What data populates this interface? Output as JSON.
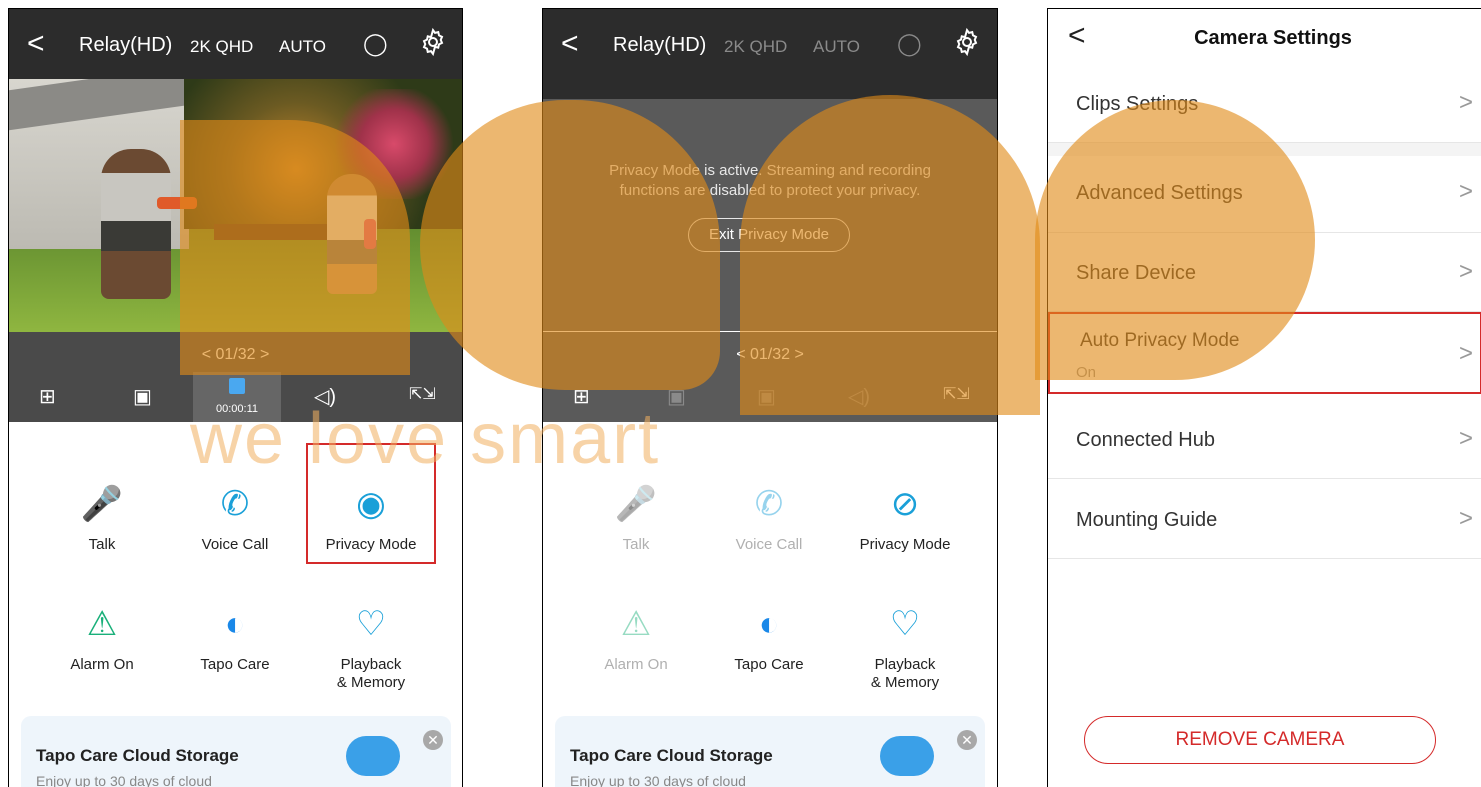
{
  "live_view": {
    "back": "<",
    "title": "Relay(HD)",
    "resolution": "2K QHD",
    "mode": "AUTO",
    "pager": "<  01/32  >",
    "rec_time": "00:00:11",
    "features": [
      {
        "icon": "microphone",
        "label": "Talk"
      },
      {
        "icon": "phone",
        "label": "Voice Call"
      },
      {
        "icon": "camera-eye",
        "label": "Privacy Mode"
      },
      {
        "icon": "alarm",
        "label": "Alarm On"
      },
      {
        "icon": "tapo-care",
        "label": "Tapo Care"
      },
      {
        "icon": "playback",
        "label": "Playback\n& Memory"
      }
    ],
    "promo_title": "Tapo Care Cloud Storage",
    "promo_desc": "Enjoy up to 30 days of cloud"
  },
  "privacy_view": {
    "back": "<",
    "title": "Relay(HD)",
    "resolution": "2K QHD",
    "mode": "AUTO",
    "message_line1": "Privacy Mode is active. Streaming and recording",
    "message_line2": "functions are disabled to protect your privacy.",
    "exit_button": "Exit Privacy Mode",
    "pager": "<  01/32  >",
    "features": [
      {
        "label": "Talk"
      },
      {
        "label": "Voice Call"
      },
      {
        "label": "Privacy Mode"
      },
      {
        "label": "Alarm On"
      },
      {
        "label": "Tapo Care"
      },
      {
        "label": "Playback\n& Memory"
      }
    ],
    "promo_title": "Tapo Care Cloud Storage",
    "promo_desc": "Enjoy up to 30 days of cloud"
  },
  "settings": {
    "back": "<",
    "title": "Camera Settings",
    "rows": [
      {
        "label": "Clips Settings"
      },
      {
        "label": "Advanced Settings"
      },
      {
        "label": "Share Device"
      },
      {
        "label": "Auto Privacy Mode",
        "sub": "On"
      },
      {
        "label": "Connected Hub"
      },
      {
        "label": "Mounting Guide"
      }
    ],
    "chevron": ">",
    "remove_button": "REMOVE CAMERA"
  },
  "watermark": "we love smart",
  "colors": {
    "accent": "#4aa8f0",
    "highlight": "#d42a2a",
    "watermark": "#e08a18"
  }
}
